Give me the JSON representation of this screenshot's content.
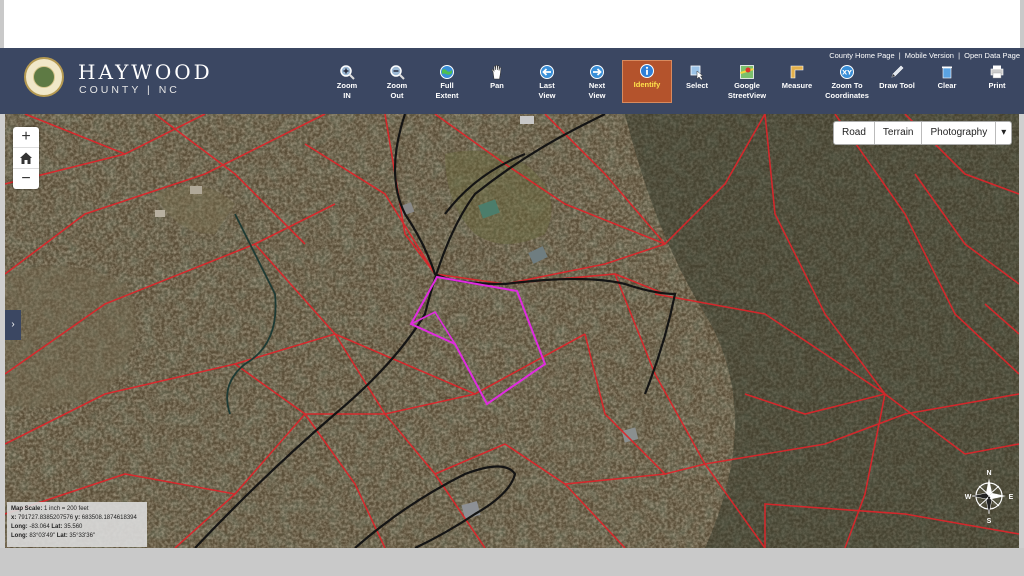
{
  "header": {
    "name": "HAYWOOD",
    "sub": "COUNTY | NC",
    "links": [
      "County Home Page",
      "Mobile Version",
      "Open Data Page"
    ],
    "link_separator": "|"
  },
  "toolbar": {
    "zoom_in": [
      "Zoom",
      "IN"
    ],
    "zoom_out": [
      "Zoom",
      "Out"
    ],
    "full_extent": [
      "Full",
      "Extent"
    ],
    "pan": [
      "Pan"
    ],
    "last_view": [
      "Last",
      "View"
    ],
    "next_view": [
      "Next",
      "View"
    ],
    "identify": [
      "Identify"
    ],
    "select": [
      "Select"
    ],
    "google_streetview": [
      "Google",
      "StreetView"
    ],
    "measure": [
      "Measure"
    ],
    "zoom_to_coordinates": [
      "Zoom To",
      "Coordinates"
    ],
    "draw_tool": [
      "Draw Tool"
    ],
    "clear": [
      "Clear"
    ],
    "print": [
      "Print"
    ]
  },
  "map_controls": {
    "zoom_in": "+",
    "home_icon": "home-icon",
    "zoom_out": "−",
    "side_toggle": "›"
  },
  "basemap": {
    "road": "Road",
    "terrain": "Terrain",
    "photography": "Photography",
    "dropdown": "▾"
  },
  "scale": {
    "scale_label": "Map Scale:",
    "scale_value": "1 inch = 200 feet",
    "x_label": "x:",
    "x_value": "791727.8385207576",
    "y_label": "y:",
    "y_value": "683508.1874618394",
    "long_label": "Long:",
    "long_value": "-83.064",
    "lat_label": "Lat:",
    "lat_value": "35.560",
    "long_dms_label": "Long:",
    "long_dms_value": "83°03'49\"",
    "lat_dms_label": "Lat:",
    "lat_dms_value": "35°33'36\""
  },
  "compass": {
    "n": "N",
    "s": "S",
    "e": "E",
    "w": "W"
  },
  "colors": {
    "header_bg": "#3b4762",
    "parcel_line": "#e0242a",
    "selected_parcel": "#e02be0",
    "road_line": "#141414",
    "stream_line": "#1e3a34",
    "identify_active": "#b4532c"
  }
}
